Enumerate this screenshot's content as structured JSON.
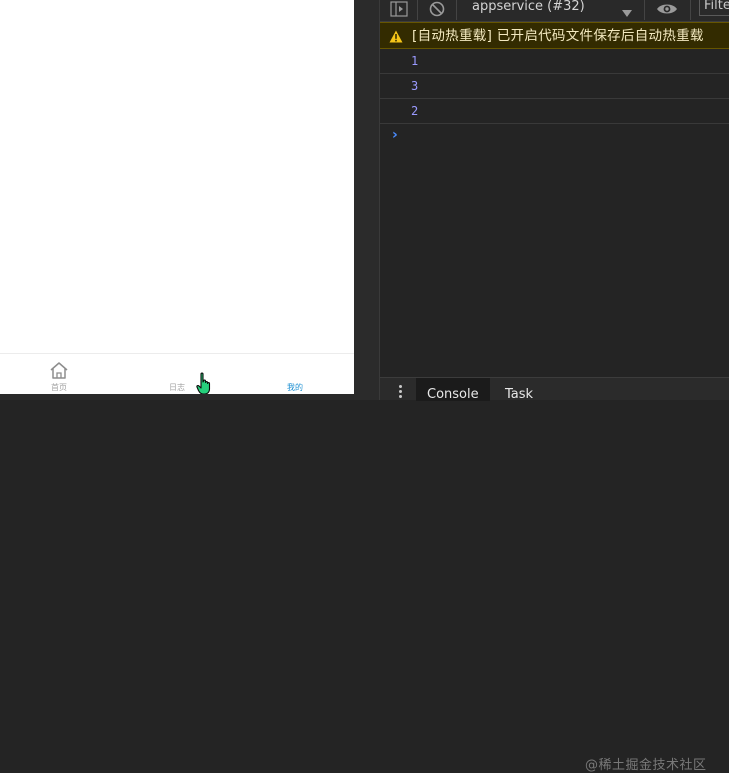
{
  "simulator": {
    "tabs": [
      {
        "label": "首页",
        "icon": "home-icon",
        "active": false
      },
      {
        "label": "日志",
        "icon": "",
        "active": false
      },
      {
        "label": "我的",
        "icon": "",
        "active": true
      }
    ]
  },
  "devtools": {
    "toolbar": {
      "context": "appservice (#32)",
      "filter_placeholder": "Filter"
    },
    "warning": {
      "icon": "warning-triangle-icon",
      "text": "[自动热重载] 已开启代码文件保存后自动热重载"
    },
    "logs": [
      "1",
      "3",
      "2"
    ],
    "prompt": "›",
    "drawer_tabs": [
      {
        "label": "Console",
        "active": true
      },
      {
        "label": "Task",
        "active": false
      }
    ]
  },
  "watermark": "@稀土掘金技术社区",
  "colors": {
    "active_tab": "#1e90d2",
    "warning_bg": "#332b00",
    "log_number": "#9a9aff",
    "prompt": "#4a8cff"
  }
}
